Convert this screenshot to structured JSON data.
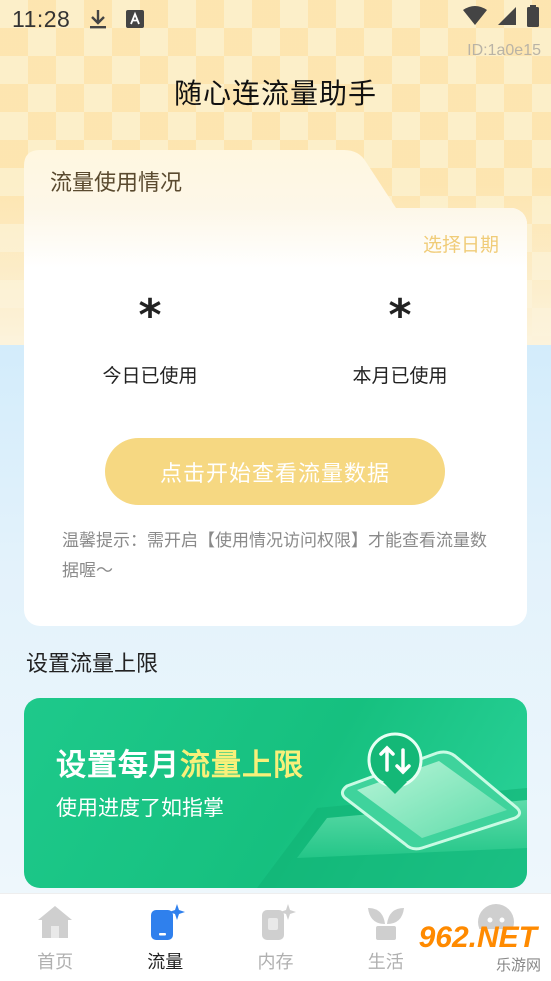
{
  "status_bar": {
    "time": "11:28",
    "icons": [
      "download-icon",
      "a-notification-icon",
      "wifi-icon",
      "signal-icon",
      "battery-icon"
    ]
  },
  "device_id": "ID:1a0e15",
  "app_title": "随心连流量助手",
  "usage_card": {
    "tab_label": "流量使用情况",
    "select_date": "选择日期",
    "today_value": "*",
    "today_label": "今日已使用",
    "month_value": "*",
    "month_label": "本月已使用",
    "start_button": "点击开始查看流量数据",
    "tip": "温馨提示：需开启【使用情况访问权限】才能查看流量数据喔～"
  },
  "limit_section": {
    "title": "设置流量上限",
    "banner_title_prefix": "设置每月",
    "banner_title_highlight": "流量上限",
    "banner_subtitle": "使用进度了如指掌"
  },
  "bottom_nav": {
    "items": [
      {
        "label": "首页",
        "icon": "home-icon"
      },
      {
        "label": "流量",
        "icon": "phone-sparkle-icon"
      },
      {
        "label": "内存",
        "icon": "memory-icon"
      },
      {
        "label": "生活",
        "icon": "plant-icon"
      },
      {
        "label": "我的",
        "icon": "profile-icon"
      }
    ],
    "active_index": 1
  },
  "watermark": {
    "brand": "962.NET",
    "sub": "乐游网"
  },
  "colors": {
    "accent_yellow": "#f6d882",
    "banner_green": "#1ec98b",
    "highlight_yellow": "#f8f07a",
    "active_blue": "#2f80ed"
  }
}
